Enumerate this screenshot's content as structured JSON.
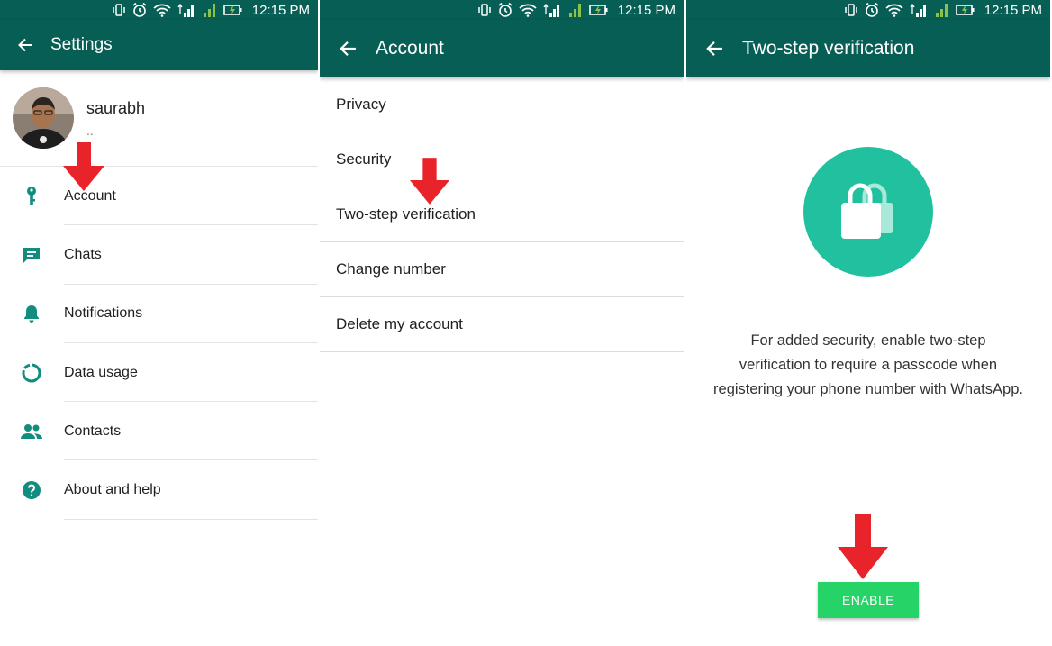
{
  "colors": {
    "header": "#075e54",
    "icon_teal": "#128c7e",
    "lock_circle": "#21c1a0",
    "enable_button": "#25d366",
    "annotation_arrow": "#e8232a"
  },
  "status_bar": {
    "time": "12:15 PM",
    "icons": [
      "vibrate-icon",
      "alarm-icon",
      "wifi-icon",
      "signal-icon",
      "signal-2-icon",
      "battery-charging-icon"
    ]
  },
  "settings_screen": {
    "title": "Settings",
    "profile": {
      "name": "saurabh",
      "status": ".."
    },
    "items": [
      {
        "label": "Account",
        "icon": "key-icon"
      },
      {
        "label": "Chats",
        "icon": "chat-icon"
      },
      {
        "label": "Notifications",
        "icon": "bell-icon"
      },
      {
        "label": "Data usage",
        "icon": "data-usage-icon"
      },
      {
        "label": "Contacts",
        "icon": "contacts-icon"
      },
      {
        "label": "About and help",
        "icon": "help-icon"
      }
    ]
  },
  "account_screen": {
    "title": "Account",
    "items": [
      {
        "label": "Privacy"
      },
      {
        "label": "Security"
      },
      {
        "label": "Two-step verification"
      },
      {
        "label": "Change number"
      },
      {
        "label": "Delete my account"
      }
    ]
  },
  "two_step_screen": {
    "title": "Two-step verification",
    "description": "For added security, enable two-step verification to require a passcode when registering your phone number with WhatsApp.",
    "enable_label": "ENABLE"
  }
}
